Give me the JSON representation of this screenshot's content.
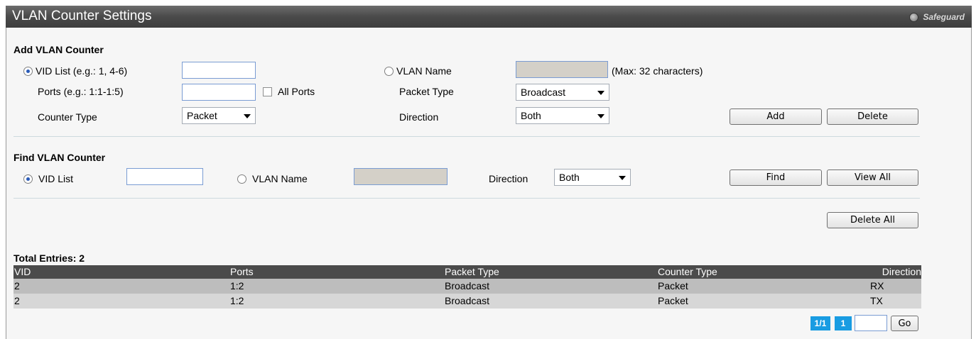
{
  "window": {
    "title": "VLAN Counter Settings",
    "safeguard_label": "Safeguard"
  },
  "add": {
    "section_title": "Add VLAN Counter",
    "vid_list_label": "VID List (e.g.: 1, 4-6)",
    "vid_list_value": "",
    "vlan_name_label": "VLAN Name",
    "vlan_name_value": "",
    "max_hint": "(Max: 32 characters)",
    "ports_label": "Ports (e.g.: 1:1-1:5)",
    "ports_value": "",
    "all_ports_label": "All Ports",
    "packet_type_label": "Packet Type",
    "packet_type_value": "Broadcast",
    "counter_type_label": "Counter Type",
    "counter_type_value": "Packet",
    "direction_label": "Direction",
    "direction_value": "Both",
    "add_button": "Add",
    "delete_button": "Delete"
  },
  "find": {
    "section_title": "Find VLAN Counter",
    "vid_list_label": "VID List",
    "vid_list_value": "",
    "vlan_name_label": "VLAN Name",
    "vlan_name_value": "",
    "direction_label": "Direction",
    "direction_value": "Both",
    "find_button": "Find",
    "view_all_button": "View All"
  },
  "delete_all_button": "Delete All",
  "total_entries": "Total Entries: 2",
  "table": {
    "headers": [
      "VID",
      "Ports",
      "Packet Type",
      "Counter Type",
      "Direction"
    ],
    "rows": [
      [
        "2",
        "1:2",
        "Broadcast",
        "Packet",
        "RX"
      ],
      [
        "2",
        "1:2",
        "Broadcast",
        "Packet",
        "TX"
      ]
    ]
  },
  "pager": {
    "summary": "1/1",
    "current_page": "1",
    "goto_value": "",
    "go_button": "Go"
  }
}
